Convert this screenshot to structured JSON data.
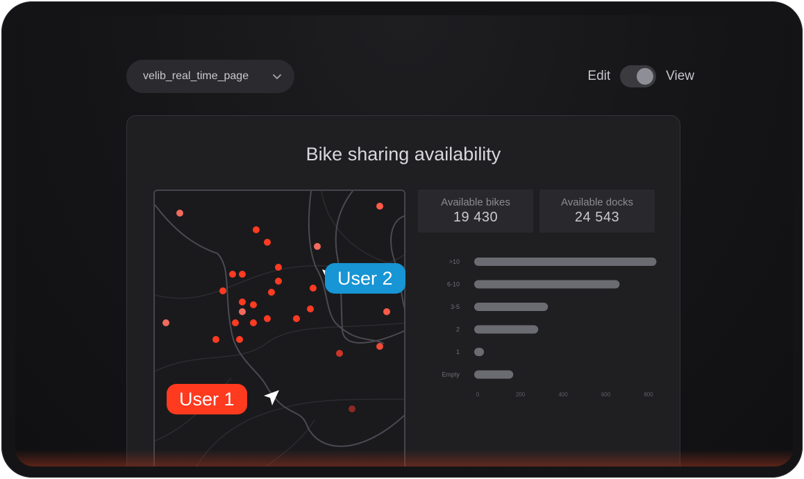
{
  "page_selector": {
    "value": "velib_real_time_page"
  },
  "mode_toggle": {
    "left_label": "Edit",
    "right_label": "View",
    "state": "View"
  },
  "dashboard": {
    "title": "Bike sharing availability",
    "stats": [
      {
        "label": "Available bikes",
        "value": "19 430"
      },
      {
        "label": "Available docks",
        "value": "24 543"
      }
    ]
  },
  "chart_data": {
    "type": "bar",
    "orientation": "horizontal",
    "categories": [
      ">10",
      "6-10",
      "3-5",
      "2",
      "1",
      "Empty"
    ],
    "values": [
      840,
      670,
      340,
      295,
      45,
      180
    ],
    "xlim": [
      0,
      800
    ],
    "xticks": [
      "0",
      "200",
      "400",
      "600",
      "800"
    ],
    "bar_color": "#6b6b72"
  },
  "users": [
    {
      "name": "User 1",
      "color": "#fe3a1f"
    },
    {
      "name": "User 2",
      "color": "#1795d4"
    }
  ],
  "colors": {
    "accent_red": "#fe3a1f",
    "accent_blue": "#1795d4",
    "background": "#141416"
  }
}
